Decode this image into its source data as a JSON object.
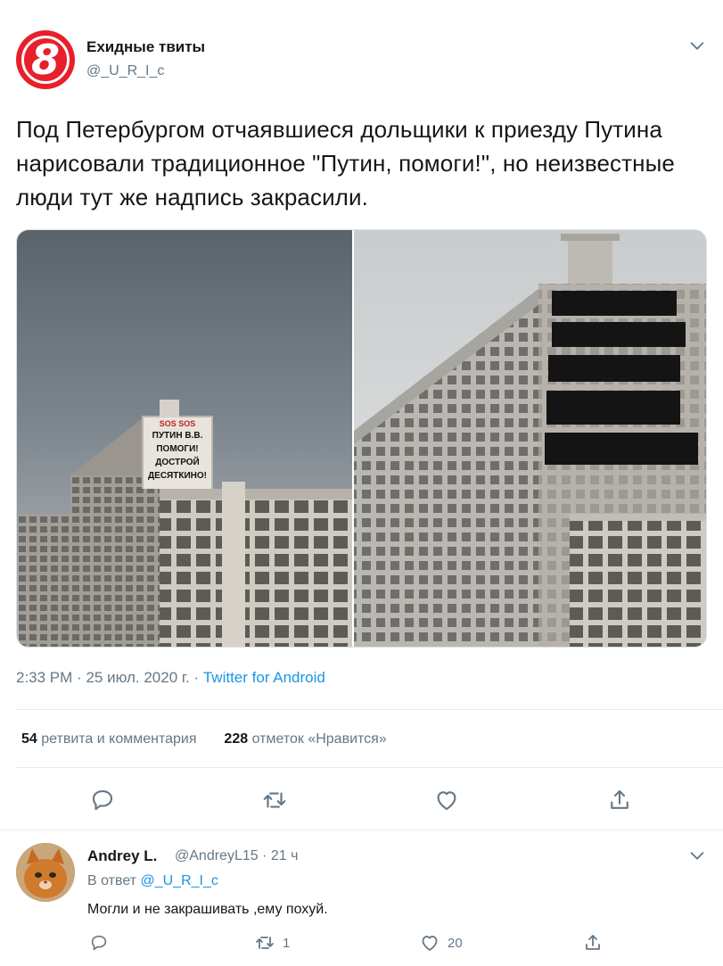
{
  "tweet": {
    "display_name": "Ехидные твиты",
    "handle": "@_U_R_I_c",
    "text": "Под Петербургом отчаявшиеся дольщики к приезду Путина нарисовали традиционное \"Путин, помоги!\", но неизвестные люди тут же надпись закрасили.",
    "building_sign": [
      "SOS SOS",
      "ПУТИН В.В.",
      "ПОМОГИ!",
      "ДОСТРОЙ",
      "ДЕСЯТКИНО!"
    ],
    "time": "2:33 PM",
    "separator": "·",
    "date": "25 июл. 2020 г.",
    "source": "Twitter for Android",
    "retweet_count": "54",
    "retweet_label": "ретвита и комментария",
    "like_count": "228",
    "like_label": "отметок «Нравится»"
  },
  "actions": {
    "icons": [
      "reply-icon",
      "retweet-icon",
      "like-icon",
      "share-icon"
    ]
  },
  "reply": {
    "display_name": "Andrey L.",
    "handle_meta": "@AndreyL15 · 21 ч",
    "in_reply_prefix": "В ответ",
    "in_reply_mention": "@_U_R_I_c",
    "text": "Могли и не закрашивать ,ему похуй.",
    "retweet_count": "1",
    "like_count": "20"
  },
  "colors": {
    "text": "#14171a",
    "secondary": "#657786",
    "link": "#1b95e0",
    "brand_red": "#e8202b",
    "divider": "#e6ecf0"
  }
}
